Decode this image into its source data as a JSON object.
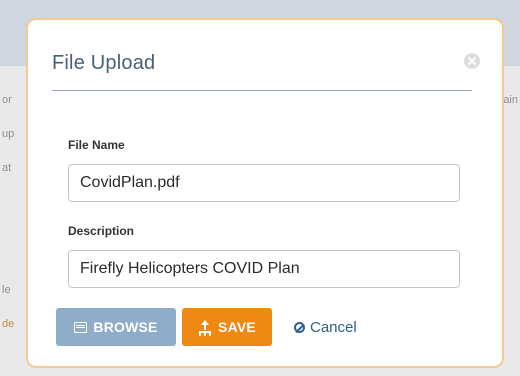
{
  "background": {
    "fragments_left": [
      "or",
      "up",
      "at",
      "le",
      "de"
    ],
    "fragments_right": [
      "ain"
    ]
  },
  "dialog": {
    "title": "File Upload",
    "file_name_label": "File Name",
    "file_name_value": "CovidPlan.pdf",
    "description_label": "Description",
    "description_value": "Firefly Helicopters COVID Plan",
    "browse_label": "BROWSE",
    "save_label": "SAVE",
    "cancel_label": "Cancel"
  },
  "colors": {
    "browse": "#8facc8",
    "save": "#ee8a14",
    "cancel_link": "#2f5f8f",
    "modal_border": "#f5c98f"
  }
}
